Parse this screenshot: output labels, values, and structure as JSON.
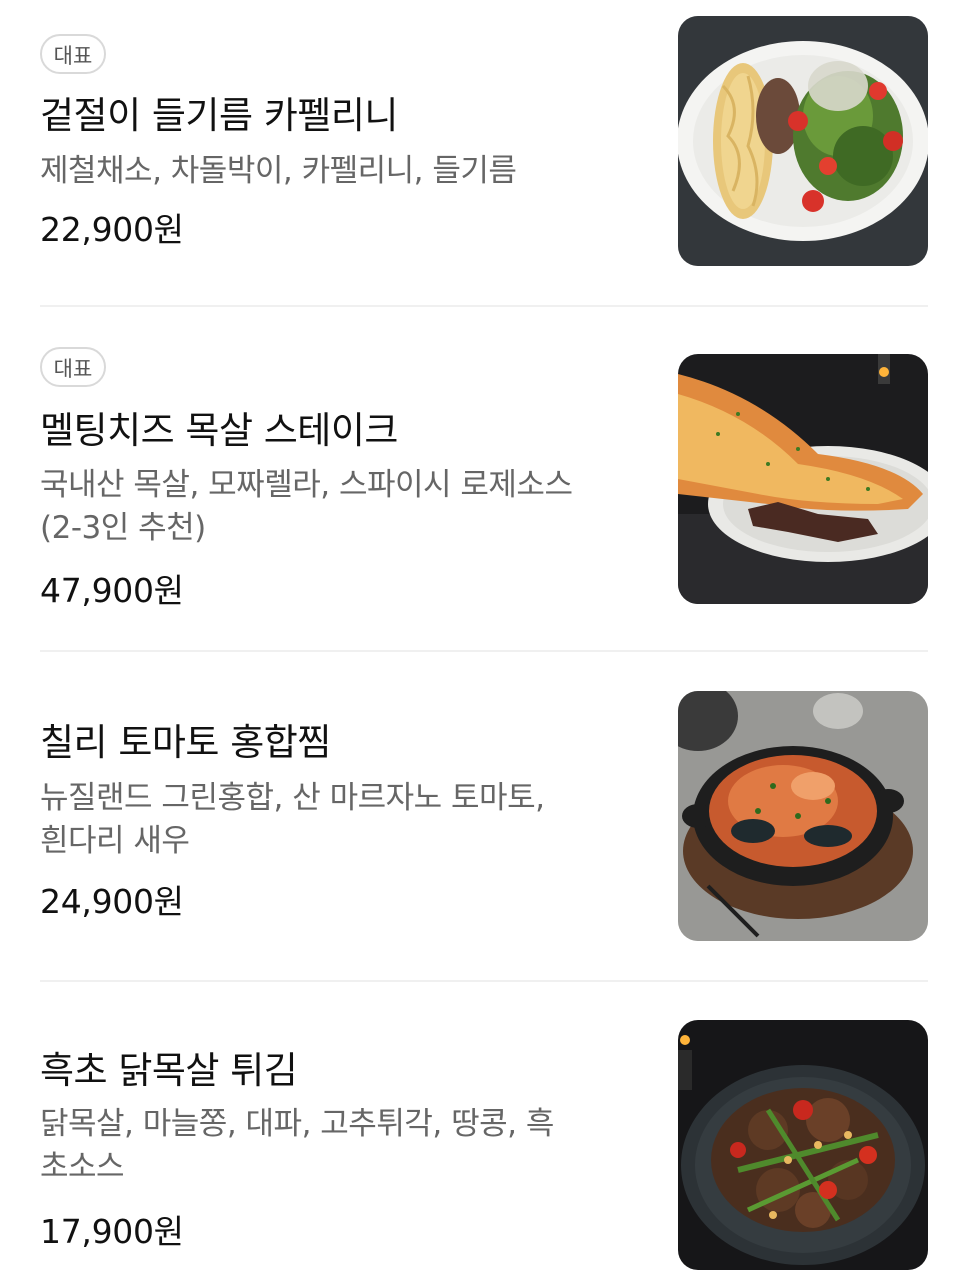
{
  "menu": {
    "items": [
      {
        "badge": "대표",
        "name": "겉절이 들기름 카펠리니",
        "desc_lines": [
          "제철채소, 차돌박이, 카펠리니, 들기름"
        ],
        "price": "22,900원",
        "photo_icon": "pasta-salad-plate-image"
      },
      {
        "badge": "대표",
        "name": "멜팅치즈 목살 스테이크",
        "desc_lines": [
          "국내산 목살, 모짜렐라, 스파이시 로제소스",
          "(2-3인 추천)"
        ],
        "price": "47,900원",
        "photo_icon": "cheese-steak-plate-image"
      },
      {
        "name": "칠리 토마토 홍합찜",
        "desc_lines": [
          "뉴질랜드 그린홍합, 산 마르자노 토마토,",
          "흰다리 새우"
        ],
        "price": "24,900원",
        "photo_icon": "mussel-skillet-image"
      },
      {
        "name": "흑초 닭목살 튀김",
        "desc_lines": [
          "닭목살, 마늘쫑, 대파, 고추튀각, 땅콩, 흑",
          "초소스"
        ],
        "price": "17,900원",
        "photo_icon": "fried-chicken-plate-image"
      }
    ]
  },
  "colors": {
    "title": "#111111",
    "description": "#666666",
    "badge_border": "#d9d9d9",
    "divider": "#f0f0f0"
  }
}
